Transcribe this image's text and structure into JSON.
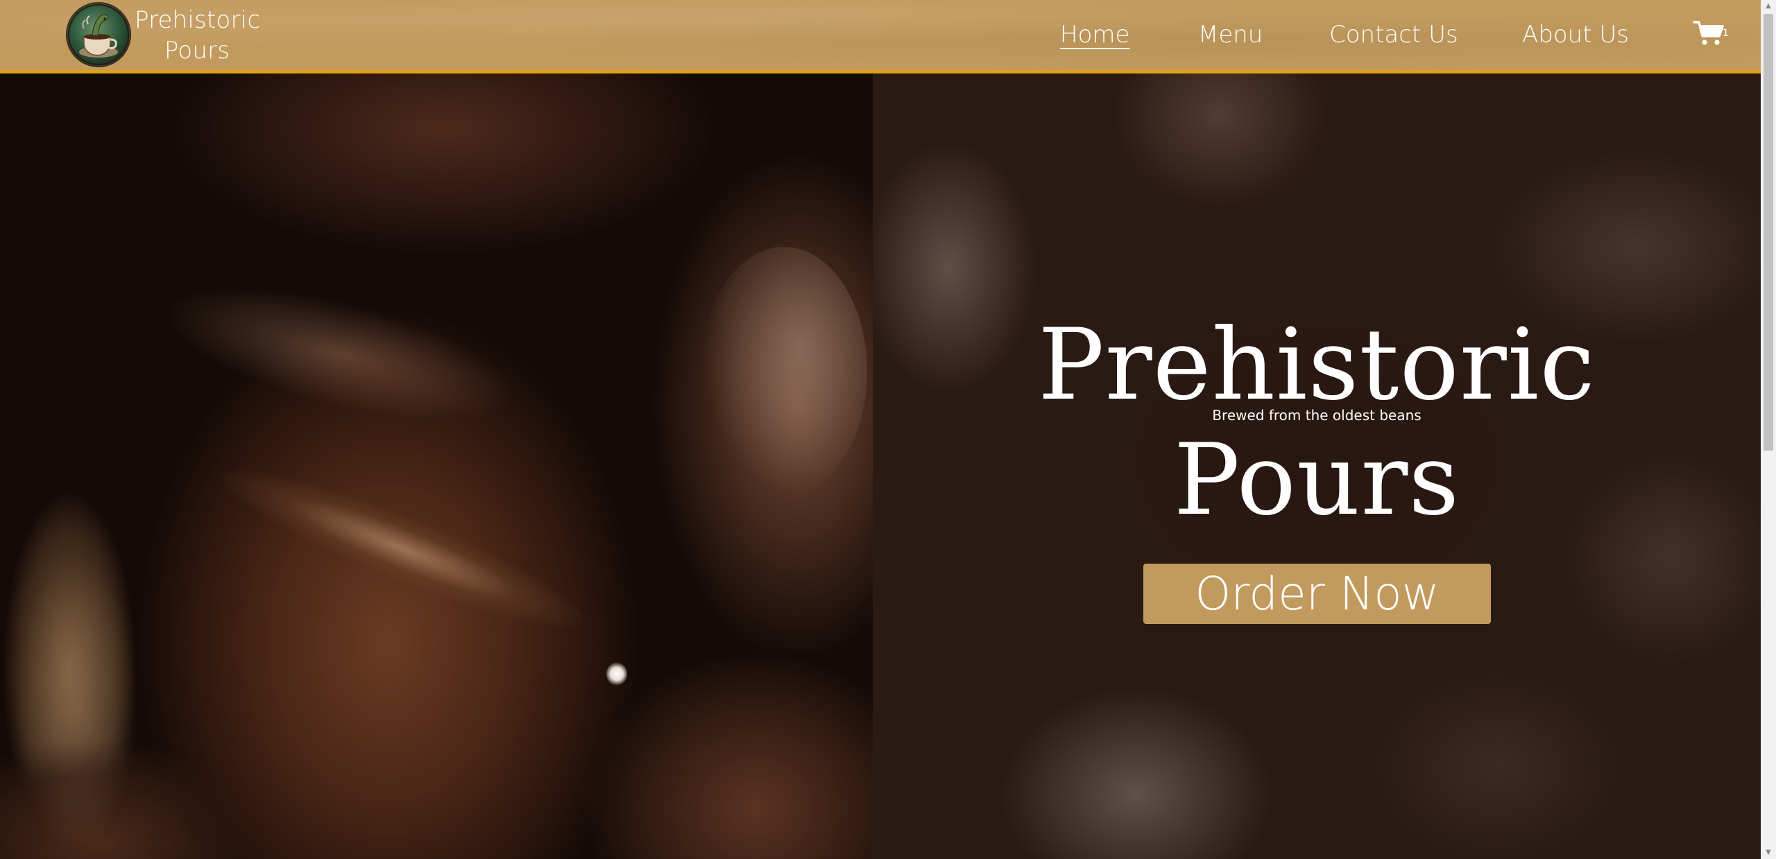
{
  "brand": {
    "line1": "Prehistoric",
    "line2": "Pours",
    "logo_icon": "dinosaur-coffee-cup-logo"
  },
  "nav": {
    "items": [
      {
        "label": "Home",
        "active": true
      },
      {
        "label": "Menu",
        "active": false
      },
      {
        "label": "Contact Us",
        "active": false
      },
      {
        "label": "About Us",
        "active": false
      }
    ],
    "cart_icon": "shopping-cart-icon",
    "cart_count": "1"
  },
  "hero": {
    "title_line1": "Prehistoric",
    "title_line2": "Pours",
    "subtitle": "Brewed from the oldest beans",
    "cta_label": "Order Now",
    "left_image": "coffee-beans-closeup",
    "right_image": "blurred-coffee-beans-background"
  },
  "colors": {
    "header_bg": "#c29a5e",
    "header_border": "#e0a21a",
    "button_bg": "#c29a5e",
    "text": "#ffffff"
  }
}
